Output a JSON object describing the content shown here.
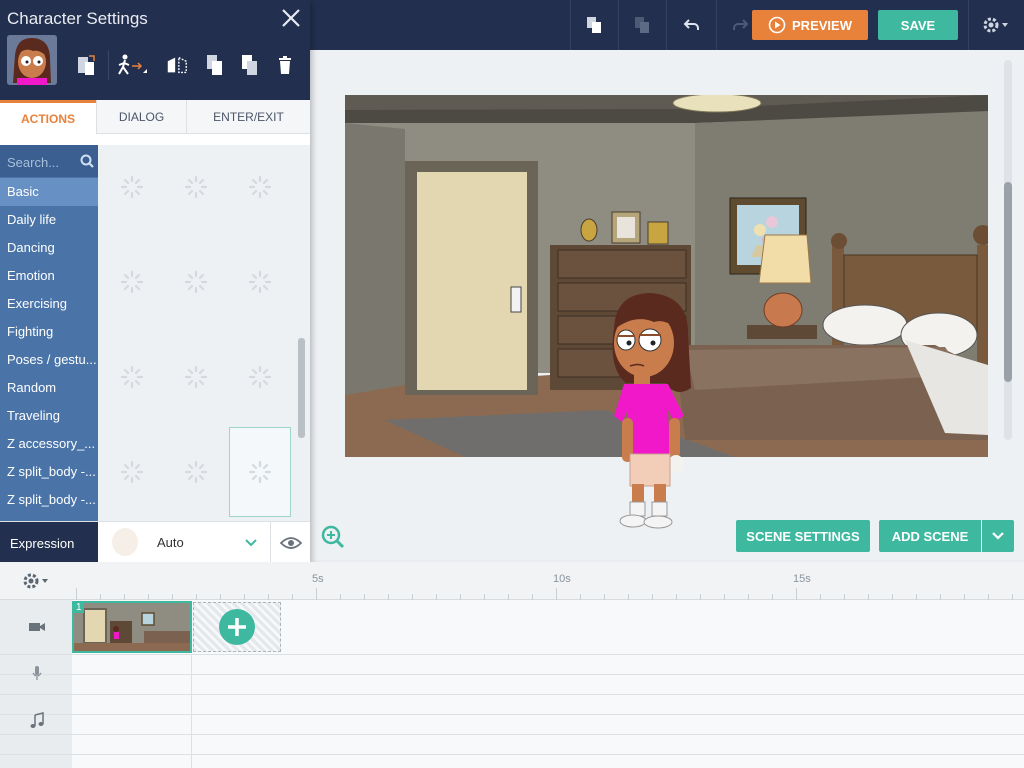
{
  "panel": {
    "title": "Character Settings",
    "tabs": [
      {
        "label": "ACTIONS",
        "active": true
      },
      {
        "label": "DIALOG",
        "active": false
      },
      {
        "label": "ENTER/EXIT",
        "active": false
      }
    ],
    "search_placeholder": "Search...",
    "categories": [
      {
        "label": "Basic",
        "active": true
      },
      {
        "label": "Daily life"
      },
      {
        "label": "Dancing"
      },
      {
        "label": "Emotion"
      },
      {
        "label": "Exercising"
      },
      {
        "label": "Fighting"
      },
      {
        "label": "Poses / gestu..."
      },
      {
        "label": "Random"
      },
      {
        "label": "Traveling"
      },
      {
        "label": "Z accessory_..."
      },
      {
        "label": "Z split_body -..."
      },
      {
        "label": "Z split_body -..."
      }
    ],
    "expression": {
      "label": "Expression",
      "value": "Auto"
    }
  },
  "toolbar": {
    "preview_label": "PREVIEW",
    "save_label": "SAVE"
  },
  "stage": {
    "scene_settings_label": "SCENE SETTINGS",
    "add_scene_label": "ADD SCENE"
  },
  "timeline": {
    "ticks": [
      "5s",
      "10s",
      "15s"
    ],
    "scenes": [
      {
        "number": "1"
      }
    ]
  },
  "colors": {
    "navy": "#232f4e",
    "accent_orange": "#e8813a",
    "accent_teal": "#3fb8a0",
    "category_blue": "#4a74a8"
  }
}
